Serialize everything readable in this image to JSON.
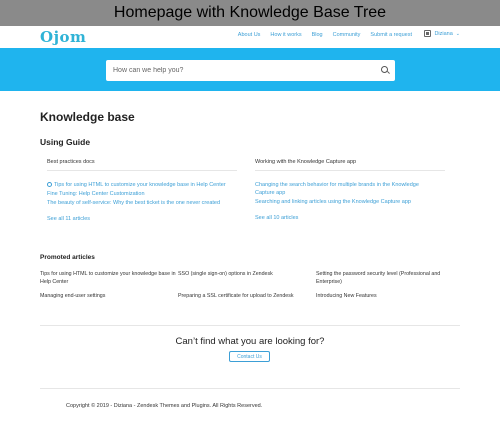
{
  "caption": "Homepage with Knowledge Base Tree",
  "header": {
    "logo_text": "Ojom",
    "nav": [
      "About Us",
      "How it works",
      "Blog",
      "Community",
      "Submit a request"
    ],
    "user_name": "Diziana",
    "user_menu_icon": "chevron-down-icon",
    "avatar_icon": "user-icon"
  },
  "hero": {
    "background_color": "#1fb4ee",
    "search_placeholder": "How can we help you?"
  },
  "main": {
    "page_title": "Knowledge base",
    "section_title": "Using Guide",
    "categories": [
      {
        "title": "Best practices docs",
        "articles": [
          "Tips for using HTML to customize your knowledge base in Help Center",
          "Fine Tuning: Help Center Customization",
          "The beauty of self-service: Why the best ticket is the one never created"
        ],
        "see_all": "See all 11 articles"
      },
      {
        "title": "Working with the Knowledge Capture app",
        "articles": [
          "Changing the search behavior for multiple brands in the Knowledge Capture app",
          "Searching and linking articles using the Knowledge Capture app"
        ],
        "see_all": "See all 10 articles"
      }
    ]
  },
  "promoted": {
    "title": "Promoted articles",
    "articles": [
      "Tips for using HTML to customize your knowledge base in Help Center",
      "SSO (single sign-on) options in Zendesk",
      "Setting the password security level (Professional and Enterprise)",
      "Managing end-user settings",
      "Preparing a SSL certificate for upload to Zendesk",
      "Introducing New Features"
    ]
  },
  "contact": {
    "heading": "Can’t find what you are looking for?",
    "button": "Contact Us"
  },
  "footer": {
    "copyright": "Copyright © 2019 - Diziana - Zendesk Themes and Plugins. All Rights Reserved."
  },
  "colors": {
    "accent": "#3c9fd6",
    "hero": "#1fb4ee",
    "logo": "#2fb3d6"
  }
}
